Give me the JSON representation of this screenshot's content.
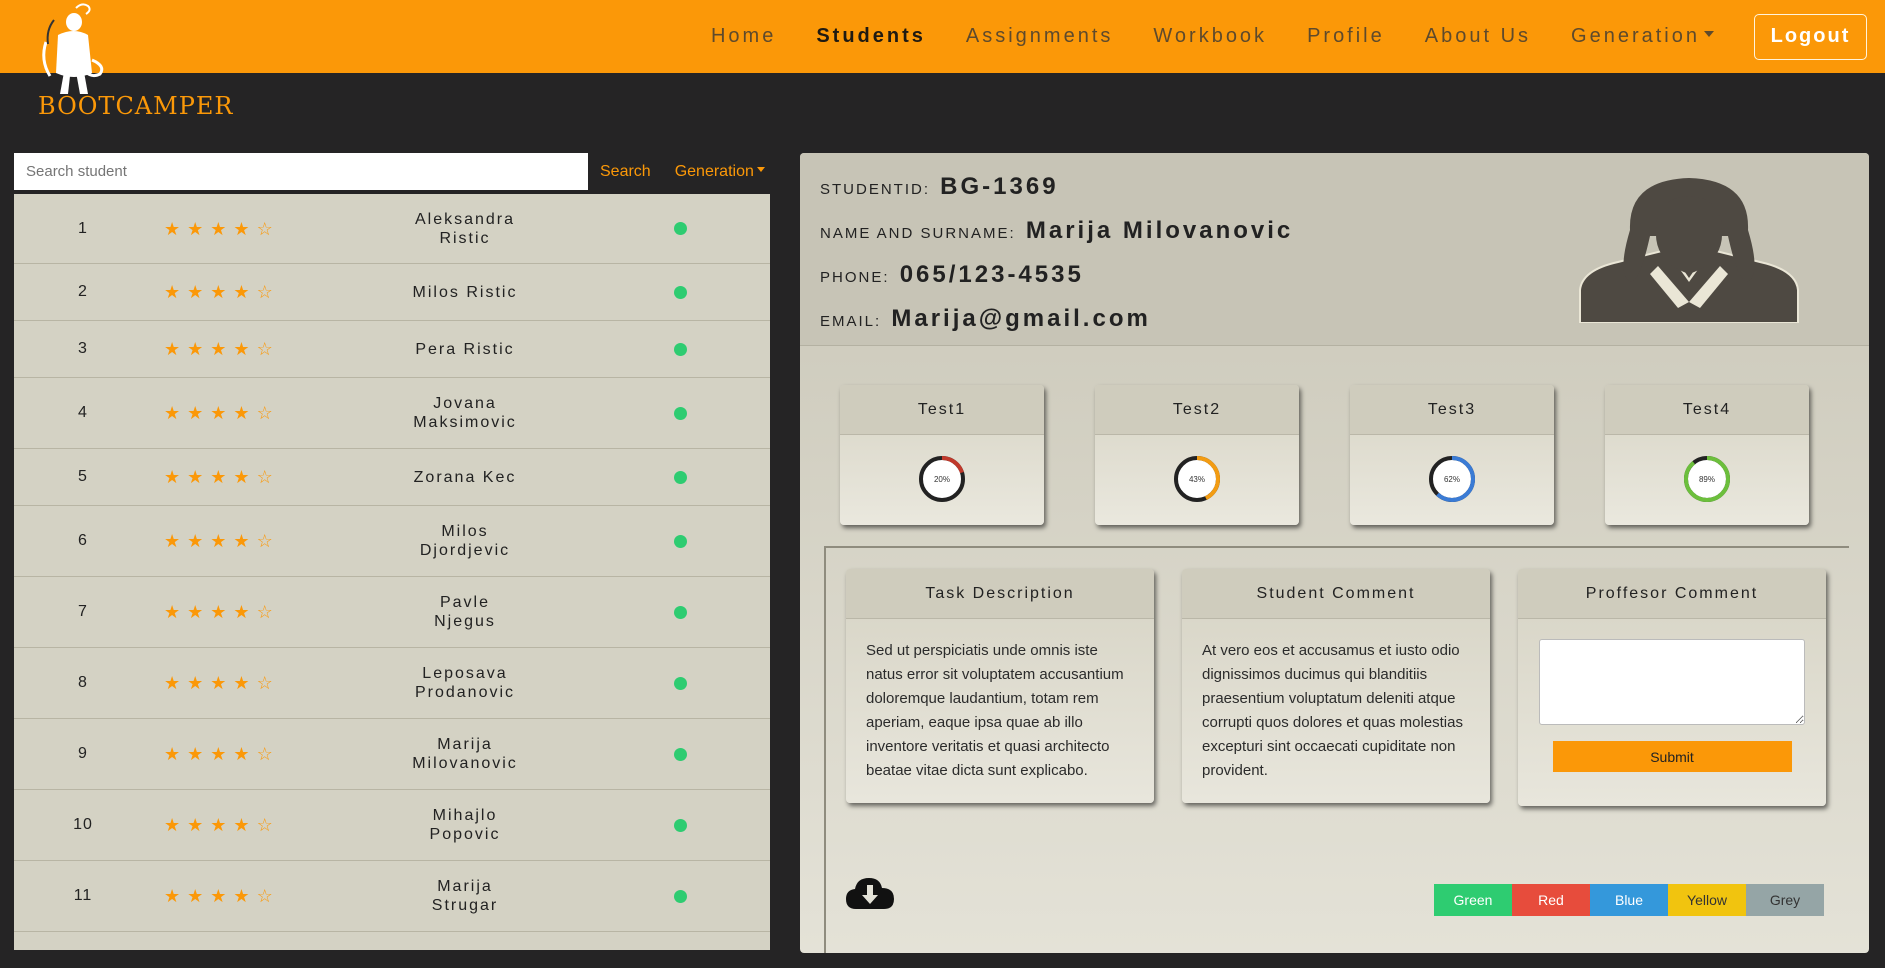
{
  "brand": {
    "logo_text": "BOOTCAMPER",
    "accent_color": "#fb9808"
  },
  "nav": {
    "items": [
      {
        "label": "Home",
        "active": false
      },
      {
        "label": "Students",
        "active": true
      },
      {
        "label": "Assignments",
        "active": false
      },
      {
        "label": "Workbook",
        "active": false
      },
      {
        "label": "Profile",
        "active": false
      },
      {
        "label": "About Us",
        "active": false
      }
    ],
    "generation_label": "Generation",
    "logout_label": "Logout"
  },
  "search": {
    "placeholder": "Search student",
    "button_label": "Search",
    "generation_label": "Generation"
  },
  "students": [
    {
      "num": "1",
      "name_line1": "Aleksandra",
      "name_line2": "Ristic",
      "rating": 4,
      "status": "green"
    },
    {
      "num": "2",
      "name_line1": "Milos Ristic",
      "name_line2": "",
      "rating": 4,
      "status": "green"
    },
    {
      "num": "3",
      "name_line1": "Pera Ristic",
      "name_line2": "",
      "rating": 4,
      "status": "green"
    },
    {
      "num": "4",
      "name_line1": "Jovana",
      "name_line2": "Maksimovic",
      "rating": 4,
      "status": "green"
    },
    {
      "num": "5",
      "name_line1": "Zorana Kec",
      "name_line2": "",
      "rating": 4,
      "status": "green"
    },
    {
      "num": "6",
      "name_line1": "Milos",
      "name_line2": "Djordjevic",
      "rating": 4,
      "status": "green"
    },
    {
      "num": "7",
      "name_line1": "Pavle",
      "name_line2": "Njegus",
      "rating": 4,
      "status": "green"
    },
    {
      "num": "8",
      "name_line1": "Leposava",
      "name_line2": "Prodanovic",
      "rating": 4,
      "status": "green"
    },
    {
      "num": "9",
      "name_line1": "Marija",
      "name_line2": "Milovanovic",
      "rating": 4,
      "status": "green"
    },
    {
      "num": "10",
      "name_line1": "Mihajlo",
      "name_line2": "Popovic",
      "rating": 4,
      "status": "green"
    },
    {
      "num": "11",
      "name_line1": "Marija",
      "name_line2": "Strugar",
      "rating": 4,
      "status": "green"
    }
  ],
  "student": {
    "id_label": "STUDENTID:",
    "id": "BG-1369",
    "name_label": "NAME AND SURNAME:",
    "name": "Marija Milovanovic",
    "phone_label": "PHONE:",
    "phone": "065/123-4535",
    "email_label": "EMAIL:",
    "email": "Marija@gmail.com"
  },
  "tests": [
    {
      "title": "Test1",
      "percent": 20,
      "percent_label": "20%",
      "color": "#c0392b"
    },
    {
      "title": "Test2",
      "percent": 43,
      "percent_label": "43%",
      "color": "#f39c12"
    },
    {
      "title": "Test3",
      "percent": 62,
      "percent_label": "62%",
      "color": "#3a7bd5"
    },
    {
      "title": "Test4",
      "percent": 89,
      "percent_label": "89%",
      "color": "#6cbf3c"
    }
  ],
  "cards": {
    "task": {
      "title": "Task Description",
      "text": "Sed ut perspiciatis unde omnis iste natus error sit voluptatem accusantium doloremque laudantium, totam rem aperiam, eaque ipsa quae ab illo inventore veritatis et quasi architecto beatae vitae dicta sunt explicabo."
    },
    "student_comment": {
      "title": "Student Comment",
      "text": "At vero eos et accusamus et iusto odio dignissimos ducimus qui blanditiis praesentium voluptatum deleniti atque corrupti quos dolores et quas molestias excepturi sint occaecati cupiditate non provident."
    },
    "professor_comment": {
      "title": "Proffesor Comment",
      "submit_label": "Submit"
    }
  },
  "color_buttons": [
    {
      "label": "Green",
      "color": "#2ecc71"
    },
    {
      "label": "Red",
      "color": "#e74c3c"
    },
    {
      "label": "Blue",
      "color": "#3498db"
    },
    {
      "label": "Yellow",
      "color": "#f1c40f"
    },
    {
      "label": "Grey",
      "color": "#95a5a6"
    }
  ]
}
